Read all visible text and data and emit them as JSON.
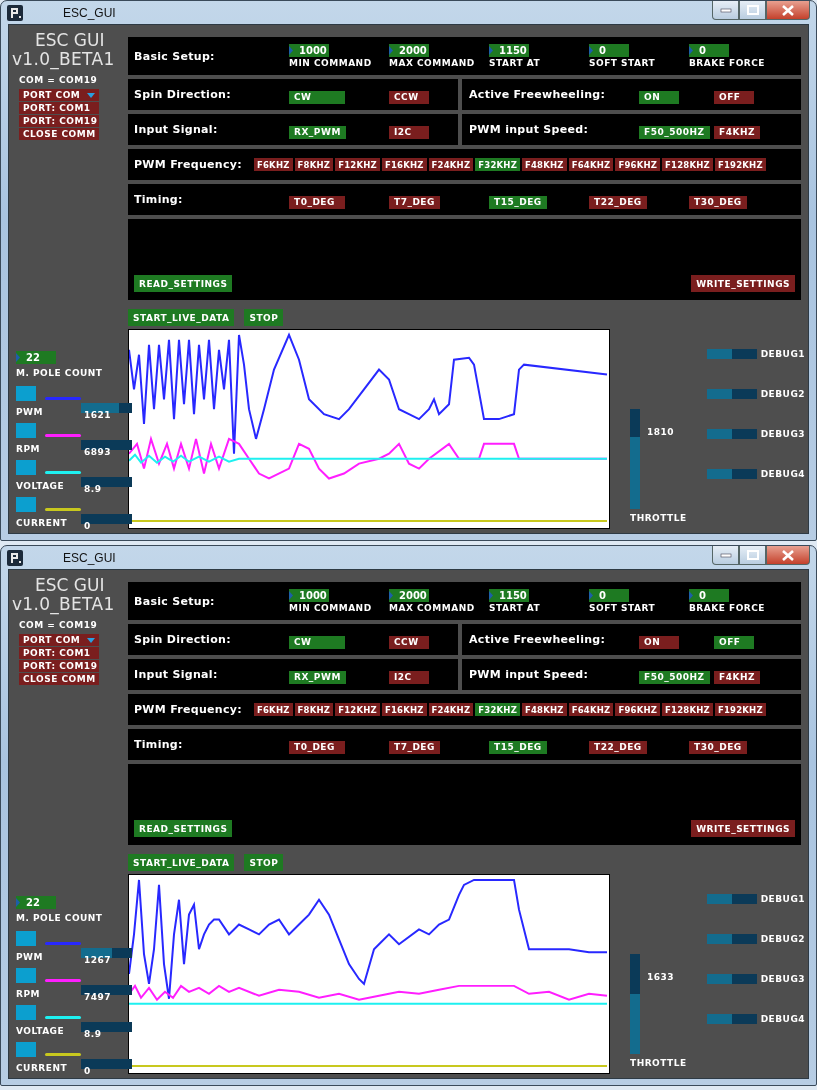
{
  "windows": [
    {
      "title": "ESC_GUI",
      "app_name": "ESC GUI",
      "version": "v1.0_BETA1",
      "com_status": "COM = COM19",
      "port_menu": {
        "label": "PORT COM",
        "items": [
          "PORT: COM1",
          "PORT: COM19",
          "CLOSE COMM"
        ]
      },
      "basic_setup": {
        "label": "Basic Setup:",
        "fields": [
          {
            "value": "1000",
            "label": "MIN COMMAND"
          },
          {
            "value": "2000",
            "label": "MAX COMMAND"
          },
          {
            "value": "1150",
            "label": "START AT"
          },
          {
            "value": "0",
            "label": "SOFT START"
          },
          {
            "value": "0",
            "label": "BRAKE FORCE"
          }
        ]
      },
      "rows": [
        {
          "groups": [
            {
              "label": "Spin Direction:",
              "options": [
                {
                  "label": "CW",
                  "selected": true
                },
                {
                  "label": "CCW",
                  "selected": false
                }
              ]
            },
            {
              "label": "Active Freewheeling:",
              "options": [
                {
                  "label": "ON",
                  "selected": true
                },
                {
                  "label": "OFF",
                  "selected": false
                }
              ]
            }
          ]
        },
        {
          "groups": [
            {
              "label": "Input Signal:",
              "options": [
                {
                  "label": "RX_PWM",
                  "selected": true
                },
                {
                  "label": "I2C",
                  "selected": false
                }
              ]
            },
            {
              "label": "PWM input Speed:",
              "options": [
                {
                  "label": "F50_500HZ",
                  "selected": true
                },
                {
                  "label": "F4KHZ",
                  "selected": false
                }
              ]
            }
          ]
        },
        {
          "groups": [
            {
              "label": "PWM Frequency:",
              "options": [
                {
                  "label": "F6KHZ",
                  "selected": false
                },
                {
                  "label": "F8KHZ",
                  "selected": false
                },
                {
                  "label": "F12KHZ",
                  "selected": false
                },
                {
                  "label": "F16KHZ",
                  "selected": false
                },
                {
                  "label": "F24KHZ",
                  "selected": false
                },
                {
                  "label": "F32KHZ",
                  "selected": true
                },
                {
                  "label": "F48KHZ",
                  "selected": false
                },
                {
                  "label": "F64KHZ",
                  "selected": false
                },
                {
                  "label": "F96KHZ",
                  "selected": false
                },
                {
                  "label": "F128KHZ",
                  "selected": false
                },
                {
                  "label": "F192KHZ",
                  "selected": false
                }
              ]
            }
          ]
        },
        {
          "groups": [
            {
              "label": "Timing:",
              "options": [
                {
                  "label": "T0_DEG",
                  "selected": false
                },
                {
                  "label": "T7_DEG",
                  "selected": false
                },
                {
                  "label": "T15_DEG",
                  "selected": true
                },
                {
                  "label": "T22_DEG",
                  "selected": false
                },
                {
                  "label": "T30_DEG",
                  "selected": false
                }
              ]
            }
          ]
        }
      ],
      "read_button": "READ_SETTINGS",
      "write_button": "WRITE_SETTINGS",
      "live_buttons": [
        "START_LIVE_DATA",
        "STOP"
      ],
      "pole_count": {
        "value": "22",
        "label": "M. POLE COUNT"
      },
      "channels": [
        {
          "label": "PWM",
          "value": "1621",
          "color": "#2828ff",
          "level": 0.75
        },
        {
          "label": "RPM",
          "value": "6893",
          "color": "#ff1eff"
        },
        {
          "label": "VOLTAGE",
          "value": "8.9",
          "color": "#1ef0f0"
        },
        {
          "label": "CURRENT",
          "value": "0",
          "color": "#c8c81e"
        }
      ],
      "throttle": {
        "value": "1810",
        "label": "THROTTLE",
        "level": 0.72
      },
      "debug": [
        {
          "label": "DEBUG1",
          "level": 0.5
        },
        {
          "label": "DEBUG2",
          "level": 0.5
        },
        {
          "label": "DEBUG3",
          "level": 0.5
        },
        {
          "label": "DEBUG4",
          "level": 0.5
        }
      ]
    },
    {
      "title": "ESC_GUI",
      "app_name": "ESC GUI",
      "version": "v1.0_BETA1",
      "com_status": "COM = COM19",
      "port_menu": {
        "label": "PORT COM",
        "items": [
          "PORT: COM1",
          "PORT: COM19",
          "CLOSE COMM"
        ]
      },
      "basic_setup": {
        "label": "Basic Setup:",
        "fields": [
          {
            "value": "1000",
            "label": "MIN COMMAND"
          },
          {
            "value": "2000",
            "label": "MAX COMMAND"
          },
          {
            "value": "1150",
            "label": "START AT"
          },
          {
            "value": "0",
            "label": "SOFT START"
          },
          {
            "value": "0",
            "label": "BRAKE FORCE"
          }
        ]
      },
      "rows": [
        {
          "groups": [
            {
              "label": "Spin Direction:",
              "options": [
                {
                  "label": "CW",
                  "selected": true
                },
                {
                  "label": "CCW",
                  "selected": false
                }
              ]
            },
            {
              "label": "Active Freewheeling:",
              "options": [
                {
                  "label": "ON",
                  "selected": false
                },
                {
                  "label": "OFF",
                  "selected": true
                }
              ]
            }
          ]
        },
        {
          "groups": [
            {
              "label": "Input Signal:",
              "options": [
                {
                  "label": "RX_PWM",
                  "selected": true
                },
                {
                  "label": "I2C",
                  "selected": false
                }
              ]
            },
            {
              "label": "PWM input Speed:",
              "options": [
                {
                  "label": "F50_500HZ",
                  "selected": true
                },
                {
                  "label": "F4KHZ",
                  "selected": false
                }
              ]
            }
          ]
        },
        {
          "groups": [
            {
              "label": "PWM Frequency:",
              "options": [
                {
                  "label": "F6KHZ",
                  "selected": false
                },
                {
                  "label": "F8KHZ",
                  "selected": false
                },
                {
                  "label": "F12KHZ",
                  "selected": false
                },
                {
                  "label": "F16KHZ",
                  "selected": false
                },
                {
                  "label": "F24KHZ",
                  "selected": false
                },
                {
                  "label": "F32KHZ",
                  "selected": true
                },
                {
                  "label": "F48KHZ",
                  "selected": false
                },
                {
                  "label": "F64KHZ",
                  "selected": false
                },
                {
                  "label": "F96KHZ",
                  "selected": false
                },
                {
                  "label": "F128KHZ",
                  "selected": false
                },
                {
                  "label": "F192KHZ",
                  "selected": false
                }
              ]
            }
          ]
        },
        {
          "groups": [
            {
              "label": "Timing:",
              "options": [
                {
                  "label": "T0_DEG",
                  "selected": false
                },
                {
                  "label": "T7_DEG",
                  "selected": false
                },
                {
                  "label": "T15_DEG",
                  "selected": true
                },
                {
                  "label": "T22_DEG",
                  "selected": false
                },
                {
                  "label": "T30_DEG",
                  "selected": false
                }
              ]
            }
          ]
        }
      ],
      "read_button": "READ_SETTINGS",
      "write_button": "WRITE_SETTINGS",
      "live_buttons": [
        "START_LIVE_DATA",
        "STOP"
      ],
      "pole_count": {
        "value": "22",
        "label": "M. POLE COUNT"
      },
      "channels": [
        {
          "label": "PWM",
          "value": "1267",
          "color": "#2828ff",
          "level": 0.6
        },
        {
          "label": "RPM",
          "value": "7497",
          "color": "#ff1eff"
        },
        {
          "label": "VOLTAGE",
          "value": "8.9",
          "color": "#1ef0f0"
        },
        {
          "label": "CURRENT",
          "value": "0",
          "color": "#c8c81e"
        }
      ],
      "throttle": {
        "value": "1633",
        "label": "THROTTLE",
        "level": 0.6
      },
      "debug": [
        {
          "label": "DEBUG1",
          "level": 0.5
        },
        {
          "label": "DEBUG2",
          "level": 0.5
        },
        {
          "label": "DEBUG3",
          "level": 0.5
        },
        {
          "label": "DEBUG4",
          "level": 0.5
        }
      ]
    }
  ]
}
